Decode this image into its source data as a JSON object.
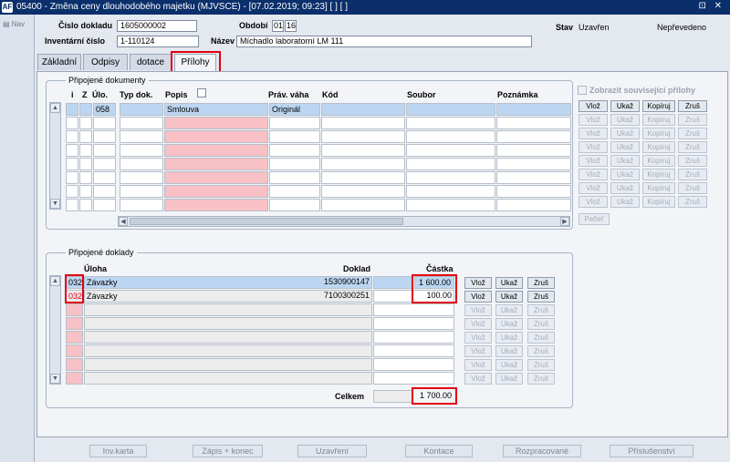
{
  "title_bar": {
    "icon": "AF",
    "title": "05400 - Změna ceny dlouhodobého majetku (MJVSCE) - [07.02.2019; 09:23]  [ ]  [ ]",
    "controls": "⊡ ✕"
  },
  "nav_label": "Nav",
  "header": {
    "cislo_dokladu_label": "Číslo dokladu",
    "cislo_dokladu": "1605000002",
    "obdobi_label": "Období",
    "obdobi_month": "01",
    "obdobi_year": "16",
    "stav_label": "Stav",
    "stav": "Uzavřen",
    "prevod": "Nepřevedeno",
    "inventarni_cislo_label": "Inventární číslo",
    "inventarni_cislo": "1-110124",
    "nazev_label": "Název",
    "nazev": "Míchadlo laboratorní LM 111"
  },
  "tabs": [
    "Základní",
    "Odpisy",
    "dotace",
    "Přílohy"
  ],
  "attached_docs": {
    "group_title": "Připojené dokumenty",
    "columns": {
      "i": "i",
      "z": "Z",
      "ulo": "Úlo.",
      "typ": "Typ dok.",
      "popis": "Popis",
      "prav": "Práv. váha",
      "kod": "Kód",
      "soubor": "Soubor",
      "poznamka": "Poznámka"
    },
    "row1": {
      "ulo": "058",
      "popis": "Smlouva",
      "prav": "Originál"
    },
    "show_related_label": "Zobrazit související přílohy",
    "btn_vloz": "Vlož",
    "btn_ukaz": "Ukaž",
    "btn_kopiruj": "Kopíruj",
    "btn_zrus": "Zruš",
    "btn_pecet": "Pečeť"
  },
  "attached_records": {
    "group_title": "Připojené doklady",
    "col_uloha": "Úloha",
    "col_doklad": "Doklad",
    "col_castka": "Částka",
    "rows": [
      {
        "code": "032",
        "uloha": "Závazky",
        "doklad": "1530900147",
        "castka": "1 600.00"
      },
      {
        "code": "032",
        "uloha": "Závazky",
        "doklad": "7100300251",
        "castka": "100.00"
      }
    ],
    "celkem_label": "Celkem",
    "celkem": "1 700.00",
    "btn_vloz": "Vlož",
    "btn_ukaz": "Ukaž",
    "btn_zrus": "Zruš"
  },
  "bottom_buttons": [
    "Inv.karta",
    "Zápis + konec",
    "Uzavření",
    "Kontace",
    "Rozpracované",
    "Příslušenství"
  ]
}
